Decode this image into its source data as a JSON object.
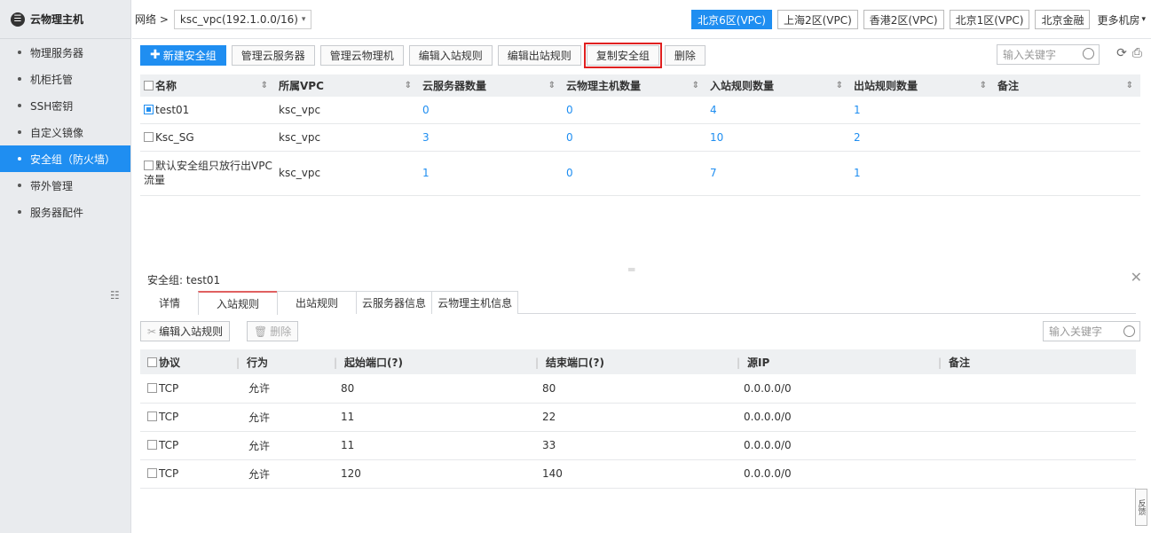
{
  "sidebar": {
    "title": "云物理主机",
    "items": [
      {
        "label": "物理服务器",
        "active": false
      },
      {
        "label": "机柜托管",
        "active": false
      },
      {
        "label": "SSH密钥",
        "active": false
      },
      {
        "label": "自定义镜像",
        "active": false
      },
      {
        "label": "安全组（防火墙）",
        "active": true
      },
      {
        "label": "带外管理",
        "active": false
      },
      {
        "label": "服务器配件",
        "active": false
      }
    ]
  },
  "topbar": {
    "breadcrumb_root": "网络 >",
    "vpc_select": "ksc_vpc(192.1.0.0/16)",
    "regions": [
      "北京6区(VPC)",
      "上海2区(VPC)",
      "香港2区(VPC)",
      "北京1区(VPC)",
      "北京金融"
    ],
    "active_region": "北京6区(VPC)",
    "more_label": "更多机房"
  },
  "toolbar": {
    "new_label": "新建安全组",
    "manage_cloud_server": "管理云服务器",
    "manage_physical": "管理云物理机",
    "edit_inbound": "编辑入站规则",
    "edit_outbound": "编辑出站规则",
    "copy_group": "复制安全组",
    "delete": "删除",
    "search_placeholder": "输入关键字"
  },
  "main_table": {
    "headers": [
      "名称",
      "所属VPC",
      "云服务器数量",
      "云物理主机数量",
      "入站规则数量",
      "出站规则数量",
      "备注"
    ],
    "rows": [
      {
        "name": "test01",
        "vpc": "ksc_vpc",
        "servers": "0",
        "physical": "0",
        "inbound": "4",
        "outbound": "1",
        "note": "",
        "checked": true
      },
      {
        "name": "Ksc_SG",
        "vpc": "ksc_vpc",
        "servers": "3",
        "physical": "0",
        "inbound": "10",
        "outbound": "2",
        "note": "",
        "checked": false
      },
      {
        "name": "默认安全组只放行出VPC流量",
        "vpc": "ksc_vpc",
        "servers": "1",
        "physical": "0",
        "inbound": "7",
        "outbound": "1",
        "note": "",
        "checked": false
      }
    ]
  },
  "detail": {
    "title": "安全组: test01",
    "tabs": [
      "详情",
      "入站规则",
      "出站规则",
      "云服务器信息",
      "云物理主机信息"
    ],
    "active_tab": "入站规则",
    "edit_inbound_label": "编辑入站规则",
    "delete_label": "删除",
    "search_placeholder": "输入关键字",
    "rule_headers": [
      "协议",
      "行为",
      "起始端口(?)",
      "结束端口(?)",
      "源IP",
      "备注"
    ],
    "rules": [
      {
        "protocol": "TCP",
        "action": "允许",
        "start": "80",
        "end": "80",
        "source": "0.0.0.0/0",
        "note": ""
      },
      {
        "protocol": "TCP",
        "action": "允许",
        "start": "11",
        "end": "22",
        "source": "0.0.0.0/0",
        "note": ""
      },
      {
        "protocol": "TCP",
        "action": "允许",
        "start": "11",
        "end": "33",
        "source": "0.0.0.0/0",
        "note": ""
      },
      {
        "protocol": "TCP",
        "action": "允许",
        "start": "120",
        "end": "140",
        "source": "0.0.0.0/0",
        "note": ""
      }
    ]
  },
  "feedback_label": "反馈",
  "colors": {
    "accent": "#1f8ef1",
    "highlight": "#e02020"
  }
}
